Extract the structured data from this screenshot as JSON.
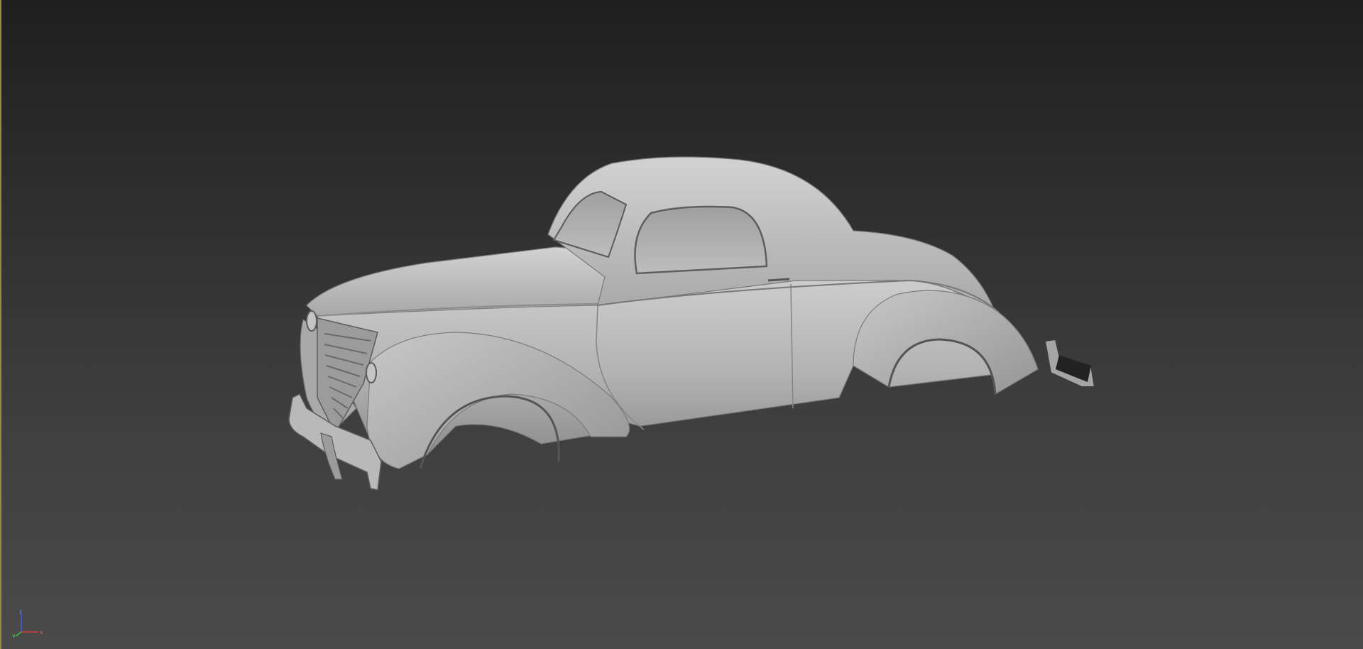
{
  "viewport": {
    "background_top": "#1f1f1f",
    "background_bottom": "#4a4a4a",
    "active_border_color": "#9a8a3a"
  },
  "model": {
    "name": "car-body-mesh",
    "shade_color": "#b4b4b4",
    "highlight_color": "#cfcfcf",
    "shadow_color": "#6e6e6e"
  },
  "axis_gizmo": {
    "x_label": "x",
    "y_label": "y",
    "z_label": "z",
    "x_color": "#d23c3c",
    "y_color": "#3cbf3c",
    "z_color": "#3c5ad2"
  }
}
